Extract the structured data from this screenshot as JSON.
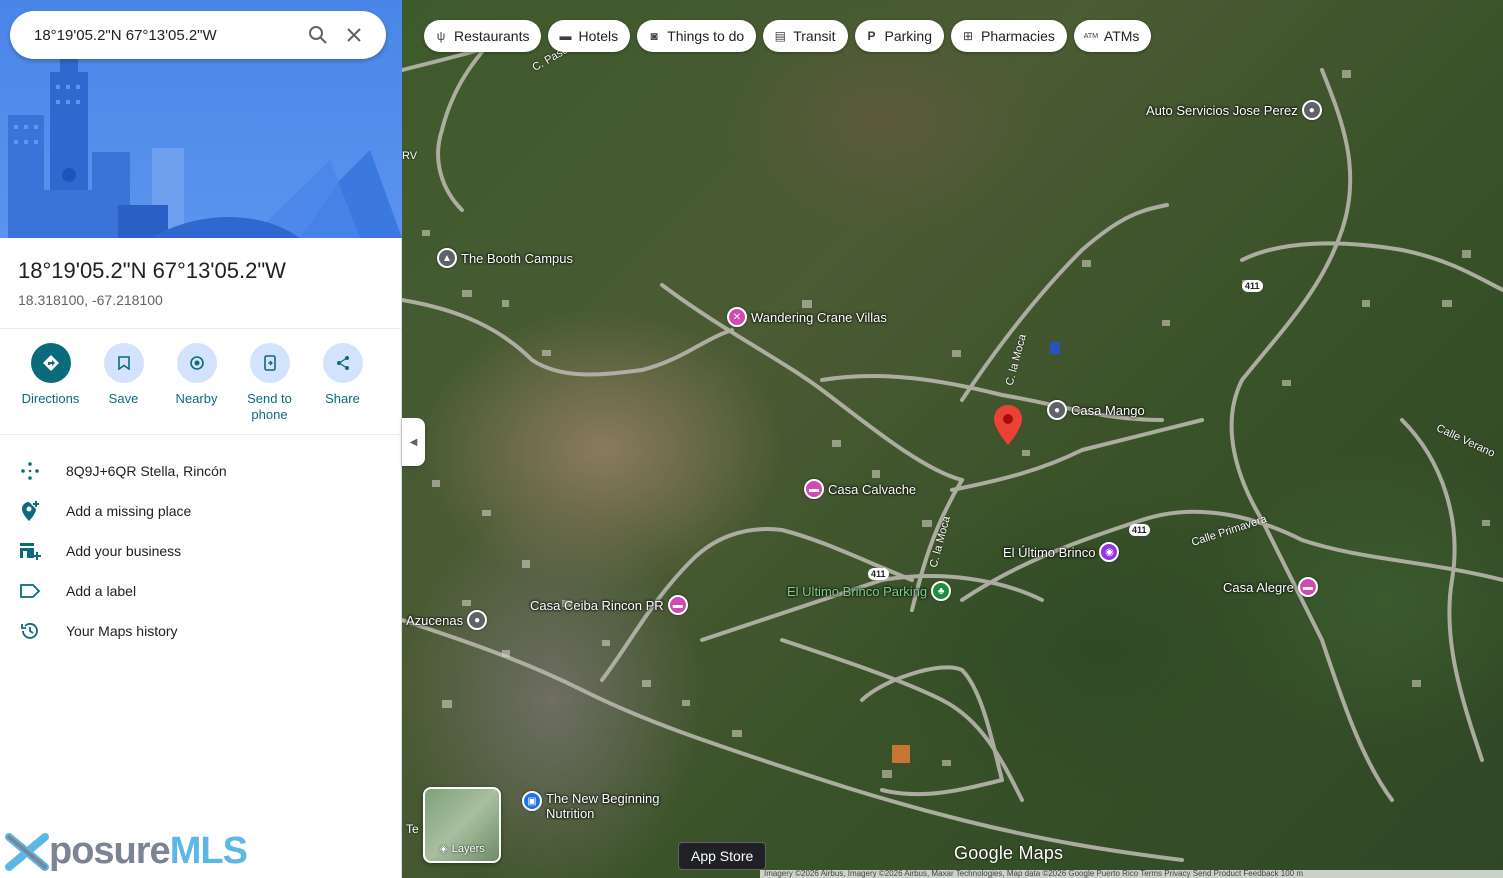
{
  "search": {
    "value": "18°19'05.2\"N 67°13'05.2\"W"
  },
  "place": {
    "title": "18°19'05.2\"N 67°13'05.2\"W",
    "coords": "18.318100, -67.218100"
  },
  "actions": [
    {
      "label": "Directions"
    },
    {
      "label": "Save"
    },
    {
      "label": "Nearby"
    },
    {
      "label": "Send to phone"
    },
    {
      "label": "Share"
    }
  ],
  "details": [
    {
      "label": "8Q9J+6QR Stella, Rincón",
      "icon": "plus-code-icon"
    },
    {
      "label": "Add a missing place",
      "icon": "add-place-icon"
    },
    {
      "label": "Add your business",
      "icon": "add-business-icon"
    },
    {
      "label": "Add a label",
      "icon": "label-icon"
    },
    {
      "label": "Your Maps history",
      "icon": "history-icon"
    }
  ],
  "chips": [
    {
      "label": "Restaurants",
      "icon": "fork-knife-icon"
    },
    {
      "label": "Hotels",
      "icon": "bed-icon"
    },
    {
      "label": "Things to do",
      "icon": "camera-icon"
    },
    {
      "label": "Transit",
      "icon": "bus-icon"
    },
    {
      "label": "Parking",
      "icon": "parking-icon"
    },
    {
      "label": "Pharmacies",
      "icon": "pharmacy-icon"
    },
    {
      "label": "ATMs",
      "icon": "atm-icon"
    }
  ],
  "pois": {
    "auto_servicios": "Auto Servicios Jose Perez",
    "booth_campus": "The Booth Campus",
    "wandering_crane": "Wandering Crane Villas",
    "casa_mango": "Casa Mango",
    "casa_calvache": "Casa Calvache",
    "el_ultimo_brinco": "El Último Brinco",
    "el_ultimo_parking": "El Ultimo Brinco Parking",
    "casa_alegre": "Casa Alegre",
    "casa_ceiba": "Casa Ceiba Rincon PR",
    "azucenas": "Azucenas",
    "new_beginning": "The New Beginning Nutrition"
  },
  "road_labels": {
    "c_pascua": "C. Pascua",
    "c_la_moca_1": "C. la Moca",
    "c_la_moca_2": "C. la Moca",
    "calle_primavera": "Calle Primavera",
    "calle_verano": "Calle Verano",
    "rv": "RV",
    "te": "Te"
  },
  "route_shields": [
    "411",
    "411",
    "411"
  ],
  "layers_label": "Layers",
  "app_store_label": "App Store",
  "google_maps_label": "Google Maps",
  "attribution": "Imagery ©2026 Airbus, Imagery ©2026 Airbus, Maxar Technologies, Map data ©2026 Google   Puerto Rico   Terms   Privacy   Send Product Feedback   100 m",
  "watermark": {
    "part1": "posure",
    "part2": "MLS"
  },
  "colors": {
    "accent": "#0b6b7a",
    "hero_blue": "#4a86e8",
    "pin_red": "#ea4335"
  }
}
